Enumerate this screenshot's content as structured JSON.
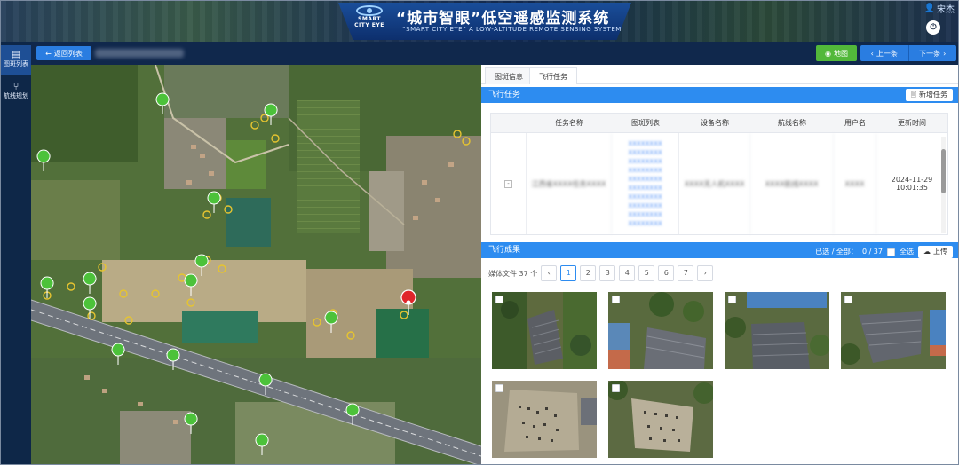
{
  "header": {
    "logo_line1": "SMART",
    "logo_line2": "CITY EYE",
    "title": "“城市智眼”低空遥感监测系统",
    "subtitle": "“SMART CITY EYE” A LOW-ALTITUDE REMOTE SENSING SYSTEM",
    "user_name": "宋杰",
    "user_icon": "user-icon",
    "power_icon": "power-icon"
  },
  "sidebar": {
    "items": [
      {
        "label": "图斑列表",
        "icon": "layers-icon",
        "active": true
      },
      {
        "label": "航线规划",
        "icon": "route-icon",
        "active": false
      }
    ]
  },
  "toolbar": {
    "back_label": "返回列表",
    "map_label": "地图",
    "prev_label": "上一条",
    "next_label": "下一条"
  },
  "tabs": [
    {
      "label": "图斑信息",
      "active": false
    },
    {
      "label": "飞行任务",
      "active": true
    }
  ],
  "flight_tasks": {
    "section_title": "飞行任务",
    "add_label": "新增任务",
    "columns": [
      "任务名称",
      "图斑列表",
      "设备名称",
      "航线名称",
      "用户名",
      "更新时间"
    ],
    "rows": [
      {
        "task_name": "江西省XXXX任务XXXX",
        "patch_list": [
          "XXXXXXXX",
          "XXXXXXXX",
          "XXXXXXXX",
          "XXXXXXXX",
          "XXXXXXXX",
          "XXXXXXXX",
          "XXXXXXXX",
          "XXXXXXXX",
          "XXXXXXXX",
          "XXXXXXXX"
        ],
        "device_name": "XXXX无人机XXXX",
        "route_name": "XXXX航线XXXX",
        "username": "XXXX",
        "update_date": "2024-11-29",
        "update_time": "10:01:35"
      }
    ]
  },
  "flight_results": {
    "section_title": "飞行成果",
    "selected_label": "已选 / 全部：",
    "selected_count": "0 / 37",
    "select_all_label": "全选",
    "upload_label": "上传",
    "media_count_label": "媒体文件 37 个",
    "pages": [
      "1",
      "2",
      "3",
      "4",
      "5",
      "6",
      "7"
    ],
    "current_page": "1",
    "thumbnails": [
      {
        "name": "photo-1"
      },
      {
        "name": "photo-2"
      },
      {
        "name": "photo-3"
      },
      {
        "name": "photo-4"
      },
      {
        "name": "photo-5"
      },
      {
        "name": "photo-6"
      }
    ]
  },
  "colors": {
    "primary": "#2d8cf0",
    "map_button": "#52b83a",
    "header_plate": "#1a4e9a",
    "marker_green": "#4cc23a",
    "marker_red": "#e0262b",
    "marker_yellow": "#e6c430"
  }
}
